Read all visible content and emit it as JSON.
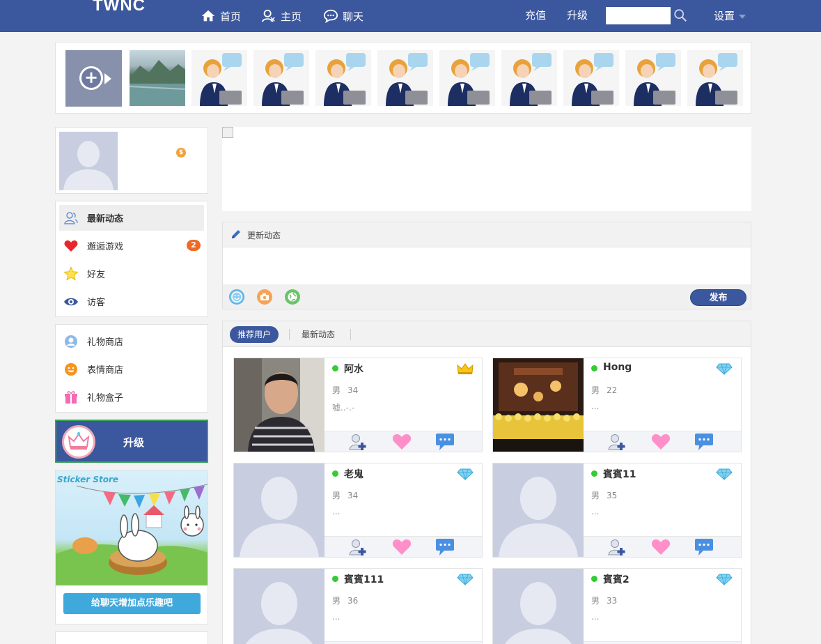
{
  "header": {
    "logo": "TWNC",
    "nav": [
      {
        "label": "首页",
        "icon": "home-icon"
      },
      {
        "label": "主页",
        "icon": "user-icon"
      },
      {
        "label": "聊天",
        "icon": "chat-icon"
      }
    ],
    "recharge": "充值",
    "upgrade": "升级",
    "search_value": "",
    "settings": "设置"
  },
  "colors": {
    "brand": "#3b579d",
    "online": "#33cc33",
    "badge": "#f06a25",
    "accent_blue": "#3fa9dc"
  },
  "profile": {
    "coin_icon": "coin-icon"
  },
  "menu_primary": [
    {
      "label": "最新动态",
      "icon": "users-outline-icon",
      "active": true,
      "badge": ""
    },
    {
      "label": "邂逅游戏",
      "icon": "heart-icon",
      "active": false,
      "badge": "2"
    },
    {
      "label": "好友",
      "icon": "star-icon",
      "active": false,
      "badge": ""
    },
    {
      "label": "访客",
      "icon": "eye-icon",
      "active": false,
      "badge": ""
    }
  ],
  "menu_secondary": [
    {
      "label": "礼物商店",
      "icon": "gift-shop-icon"
    },
    {
      "label": "表情商店",
      "icon": "smiley-icon"
    },
    {
      "label": "礼物盒子",
      "icon": "gift-box-icon"
    }
  ],
  "upgrade_card": {
    "label": "升级"
  },
  "sticker_promo": {
    "title": "Sticker Store",
    "button": "给聊天增加点乐趣吧"
  },
  "status_box": {
    "title": "更新动态",
    "publish": "发布"
  },
  "users_panel": {
    "tabs": [
      "推荐用户",
      "最新动态"
    ]
  },
  "users": [
    {
      "name": "阿水",
      "gender": "男",
      "age": "34",
      "signature": "嘘..-.-",
      "rank": "crown",
      "photo": "man"
    },
    {
      "name": "Hong",
      "gender": "男",
      "age": "22",
      "signature": "...",
      "rank": "diamond",
      "photo": "stage"
    },
    {
      "name": "老鬼",
      "gender": "男",
      "age": "34",
      "signature": "...",
      "rank": "diamond",
      "photo": "default"
    },
    {
      "name": "賓賓11",
      "gender": "男",
      "age": "35",
      "signature": "...",
      "rank": "diamond",
      "photo": "default"
    },
    {
      "name": "賓賓111",
      "gender": "男",
      "age": "36",
      "signature": "...",
      "rank": "diamond",
      "photo": "default"
    },
    {
      "name": "賓賓2",
      "gender": "男",
      "age": "33",
      "signature": "...",
      "rank": "diamond",
      "photo": "default"
    }
  ]
}
